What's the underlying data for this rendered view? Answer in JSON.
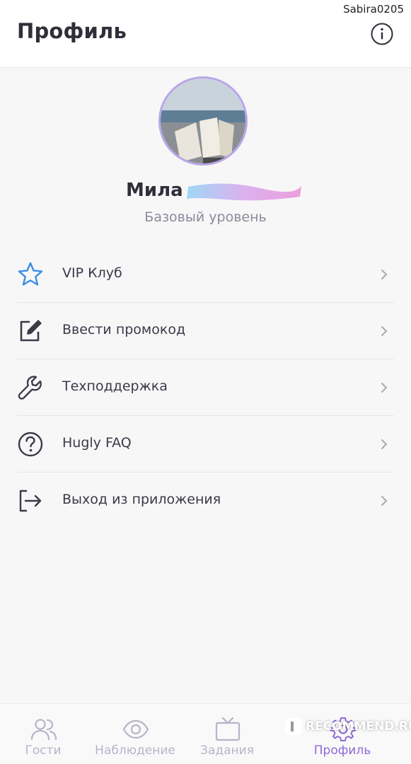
{
  "status": {
    "username_overlay": "Sabira0205"
  },
  "header": {
    "title": "Профиль",
    "info_icon": "info-icon"
  },
  "profile": {
    "name": "Мила",
    "level": "Базовый уровень",
    "avatar_description_icon": "avatar-photo"
  },
  "menu": {
    "items": [
      {
        "label": "VIP Клуб",
        "icon": "star-icon"
      },
      {
        "label": "Ввести промокод",
        "icon": "edit-icon"
      },
      {
        "label": "Техподдержка",
        "icon": "wrench-icon"
      },
      {
        "label": "Hugly FAQ",
        "icon": "question-icon"
      },
      {
        "label": "Выход из приложения",
        "icon": "logout-icon"
      }
    ]
  },
  "tabs": [
    {
      "label": "Гости",
      "icon": "users-icon",
      "active": false
    },
    {
      "label": "Наблюдение",
      "icon": "eye-icon",
      "active": false
    },
    {
      "label": "Задания",
      "icon": "tv-icon",
      "active": false
    },
    {
      "label": "Профиль",
      "icon": "gear-icon",
      "active": true
    }
  ],
  "watermark": {
    "text": "RECOMMEND.RU"
  },
  "colors": {
    "accent": "#8e6ad6",
    "star": "#3a8ee6",
    "text": "#2f2f3a",
    "muted": "#8a8a9a"
  }
}
